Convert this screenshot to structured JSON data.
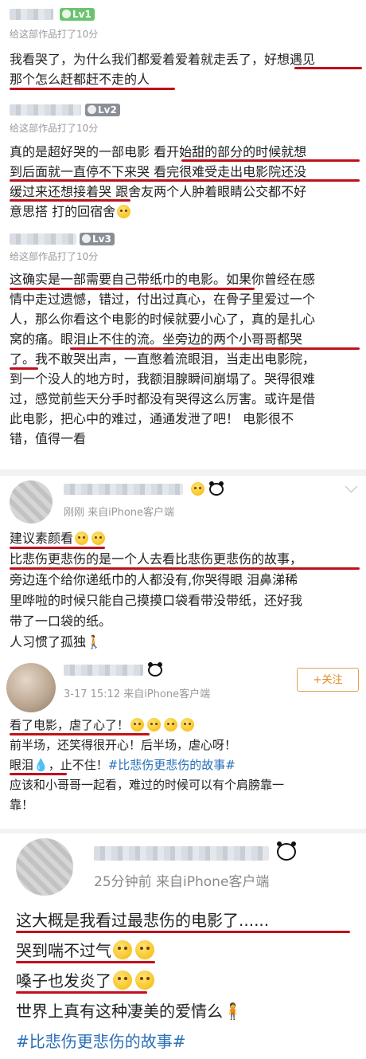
{
  "reviews": [
    {
      "level": "Lv1",
      "level_color": "#6cc36f",
      "meta": "给这部作品打了10分",
      "lines": [
        "我看哭了，为什么我们都爱着爱着就走丢了，好想遇见",
        "那个怎么赶都赶不走的人"
      ]
    },
    {
      "level": "Lv2",
      "level_color": "#8a8f97",
      "meta": "给这部作品打了10分",
      "lines": [
        "真的是超好哭的一部电影 看开始甜的部分的时候就想",
        "到后面就一直停不下来哭 看完很难受走出电影院还没",
        "缓过来还想接着哭 跟舍友两个人肿着眼睛公交都不好",
        "意思搭 打的回宿舍"
      ]
    },
    {
      "level": "Lv3",
      "level_color": "#8a8f97",
      "meta": "给这部作品打了10分",
      "lines": [
        "这确实是一部需要自己带纸巾的电影。如果你曾经在感",
        "情中走过遗憾，错过，付出过真心，在骨子里爱过一个",
        "人，那么你看这个电影的时候就要小心了，真的是扎心",
        "窝的痛。眼泪止不住的流。坐旁边的两个小哥哥都哭",
        "了。我不敢哭出声，一直憋着流眼泪，当走出电影院，",
        "到一个没人的地方时，我额泪腺瞬间崩塌了。哭得很难",
        "过，感觉前些天分手时都没有哭得这么厉害。或许是借",
        "此电影，把心中的难过，通通发泄了吧！ 电影很不",
        "错，值得一看"
      ]
    }
  ],
  "posts": [
    {
      "meta": "刚刚  来自iPhone客户端",
      "lines": [
        "建议素颜看",
        "比悲伤更悲伤的是一个人去看比悲伤更悲伤的故事，",
        "旁边连个给你递纸巾的人都没有,你哭得眼 泪鼻涕稀",
        "里哗啦的时候只能自己摸摸口袋看带没带纸，还好我",
        "带了一口袋的纸。",
        "人习惯了孤独"
      ]
    },
    {
      "meta": "3-17 15:12  来自iPhone客户端",
      "follow": "+关注",
      "lines": [
        "看了电影，虐了心了！",
        "前半场，还笑得很开心！后半场，虐心呀！",
        "眼泪",
        "，止不住！",
        "#比悲伤更悲伤的故事#",
        "应该和小哥哥一起看，难过的时候可以有个肩膀靠一",
        "靠！"
      ]
    },
    {
      "meta": "25分钟前  来自iPhone客户端",
      "lines": [
        "这大概是我看过最悲伤的电影了......",
        "哭到喘不过气",
        "嗓子也发炎了",
        "世界上真有这种凄美的爱情么",
        "#比悲伤更悲伤的故事#"
      ]
    }
  ],
  "colors": {
    "underline": "#c0111a",
    "hashtag": "#2a6fb8",
    "follow": "#e08a1c"
  }
}
